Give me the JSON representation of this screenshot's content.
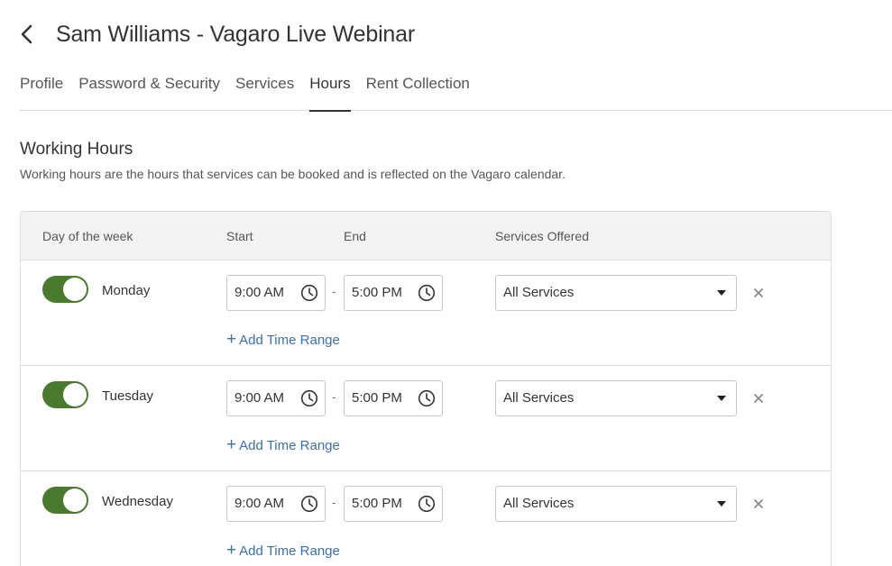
{
  "header": {
    "title": "Sam Williams - Vagaro Live Webinar",
    "back_icon": "chevron-left-icon"
  },
  "tabs": [
    {
      "label": "Profile",
      "active": false
    },
    {
      "label": "Password & Security",
      "active": false
    },
    {
      "label": "Services",
      "active": false
    },
    {
      "label": "Hours",
      "active": true
    },
    {
      "label": "Rent Collection",
      "active": false
    }
  ],
  "section": {
    "title": "Working Hours",
    "description": "Working hours are the hours that services can be booked and is reflected on the Vagaro calendar."
  },
  "table": {
    "columns": {
      "day": "Day of the week",
      "start": "Start",
      "end": "End",
      "services": "Services Offered"
    },
    "rows": [
      {
        "day": "Monday",
        "enabled": true,
        "start": "9:00 AM",
        "separator": "-",
        "end": "5:00 PM",
        "services": "All Services",
        "add_label": "Add Time Range"
      },
      {
        "day": "Tuesday",
        "enabled": true,
        "start": "9:00 AM",
        "separator": "-",
        "end": "5:00 PM",
        "services": "All Services",
        "add_label": "Add Time Range"
      },
      {
        "day": "Wednesday",
        "enabled": true,
        "start": "9:00 AM",
        "separator": "-",
        "end": "5:00 PM",
        "services": "All Services",
        "add_label": "Add Time Range"
      }
    ]
  },
  "colors": {
    "toggle_on": "#4a7a2e",
    "link": "#3a6fb0",
    "header_bg": "#f3f3f3"
  }
}
